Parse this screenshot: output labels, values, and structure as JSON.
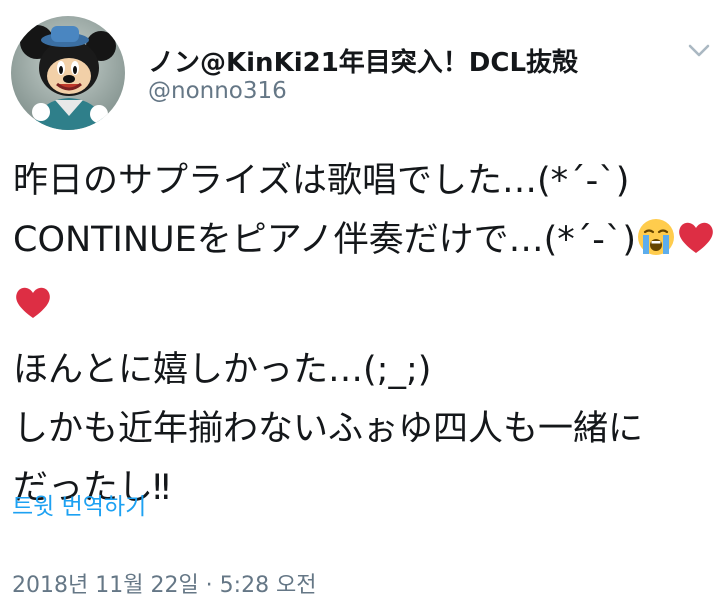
{
  "tweet": {
    "display_name": "ノン@KinKi21年目突入！DCL抜殻",
    "handle": "@nonno316",
    "body_lines": [
      "昨日のサプライズは歌唱でした…(*´-`)",
      "CONTINUEをピアノ伴奏だけで…(*´-`)",
      "",
      "ほんとに嬉しかった…(;_;)",
      "しかも近年揃わないふぉゆ四人も一緒に",
      "だったし‼"
    ],
    "emoji": {
      "face": "loudly-crying-face",
      "heart": "red-heart"
    },
    "translate_label": "트윗 번역하기",
    "timestamp": "2018년 11월 22일 · 5:28 오전"
  },
  "colors": {
    "text": "#14171a",
    "secondary": "#657786",
    "link": "#1da1f2",
    "heart": "#e0245e"
  },
  "icons": {
    "menu": "chevron-down-icon",
    "avatar": "mickey-mouse-avatar"
  }
}
